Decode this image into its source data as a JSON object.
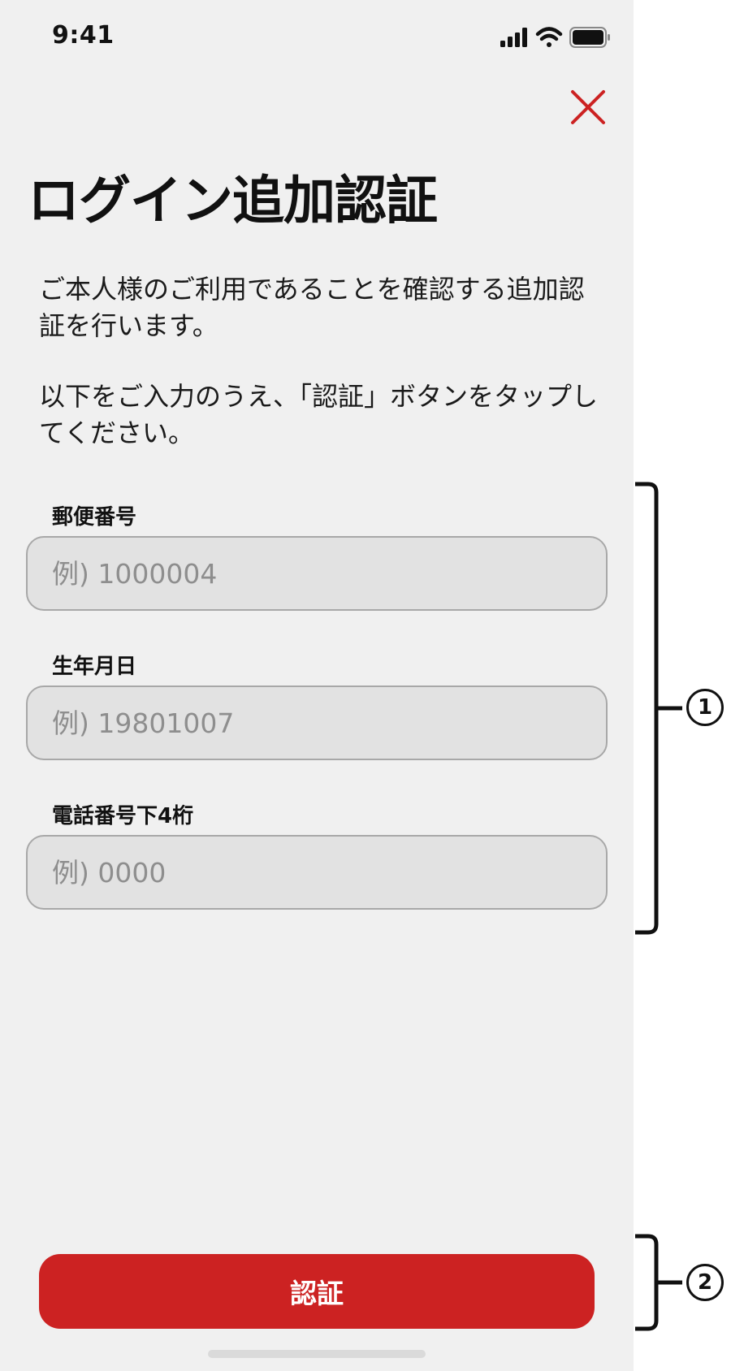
{
  "status_bar": {
    "time": "9:41",
    "icons": [
      "signal-icon",
      "wifi-icon",
      "battery-icon"
    ]
  },
  "header": {
    "close_icon": "close-icon",
    "title": "ログイン追加認証"
  },
  "description": {
    "line1": "ご本人様のご利用であることを確認する追加認証を行います。",
    "line2": "以下をご入力のうえ、「認証」ボタンをタップしてください。"
  },
  "form": {
    "fields": [
      {
        "label": "郵便番号",
        "value": "",
        "placeholder": "例) 1000004"
      },
      {
        "label": "生年月日",
        "value": "",
        "placeholder": "例) 19801007"
      },
      {
        "label": "電話番号下4桁",
        "value": "",
        "placeholder": "例) 0000"
      }
    ],
    "submit_label": "認証"
  },
  "annotations": {
    "fields_marker": "1",
    "button_marker": "2"
  },
  "colors": {
    "accent": "#cc2222",
    "background": "#f0f0f0",
    "input_bg": "#e2e2e2"
  }
}
